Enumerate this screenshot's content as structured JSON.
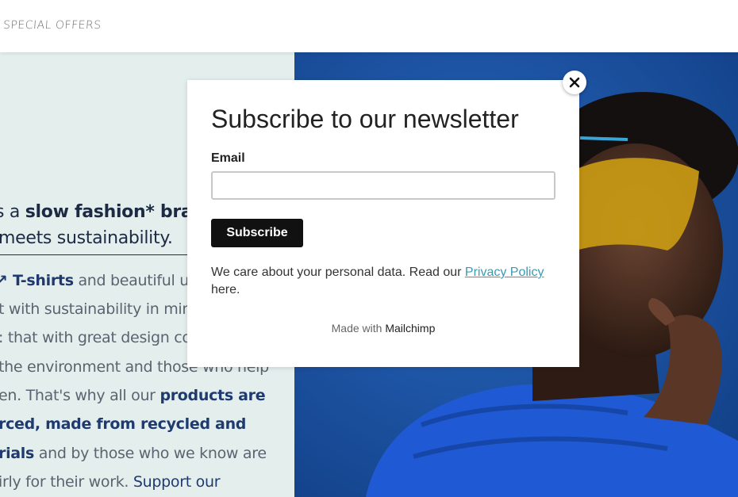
{
  "nav": {
    "special_offers": "SPECIAL OFFERS"
  },
  "hero": {
    "line1_prefix": "s a ",
    "line1_bold": "slow fashion* brand,",
    "line2": "meets sustainability."
  },
  "body_text": {
    "l1_em": "T-shirts",
    "l1_rest": " and beautiful unic",
    "l2": "t with sustainability in mind",
    "l3": ": that with great design co",
    "l4": " the environment and those who help",
    "l5_prefix": "en. That's why all our ",
    "l5_em": "products are",
    "l6_em": "rced, made from recycled and",
    "l7_em": "rials",
    "l7_rest": " and by those who we know are",
    "l8_prefix": "irly for their work. ",
    "l8_link": "Support our"
  },
  "popup": {
    "close_icon": "close-icon",
    "title": "Subscribe to our newsletter",
    "email_label": "Email",
    "email_value": "",
    "subscribe_label": "Subscribe",
    "privacy_prefix": "We care about your personal data. Read our ",
    "privacy_link": "Privacy Policy",
    "privacy_suffix": "here.",
    "made_with_prefix": "Made with ",
    "made_with_brand": "Mailchimp"
  },
  "colors": {
    "left_panel_bg": "#e4efed",
    "photo_blue": "#1a4fa0",
    "subscribe_bg": "#111111",
    "link": "#3a9bb3",
    "accent_navy": "#1e3a6e"
  }
}
